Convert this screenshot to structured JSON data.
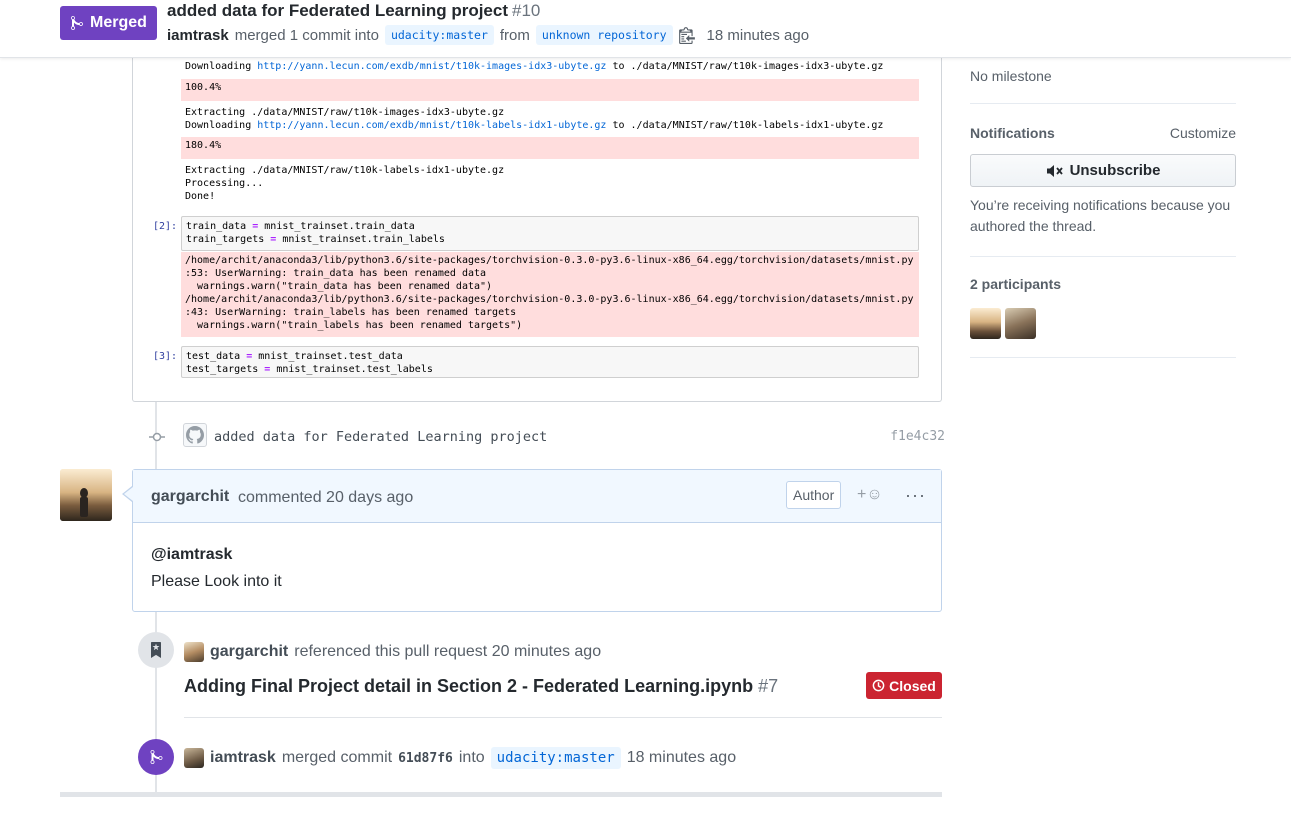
{
  "header": {
    "status_label": "Merged",
    "title": "added data for Federated Learning project",
    "number": "#10",
    "author": "iamtrask",
    "merge_text": "merged 1 commit into",
    "base_branch": "udacity:master",
    "from_text": "from",
    "head_branch": "unknown repository",
    "time": "18 minutes ago"
  },
  "notebook": {
    "line_download1_prefix": "Downloading ",
    "line_download1_url": "http://yann.lecun.com/exdb/mnist/t10k-images-idx3-ubyte.gz",
    "line_download1_suffix": " to ./data/MNIST/raw/t10k-images-idx3-ubyte.gz",
    "progress1": "100.4%",
    "extract1": "Extracting ./data/MNIST/raw/t10k-images-idx3-ubyte.gz",
    "line_download2_prefix": "Downloading ",
    "line_download2_url": "http://yann.lecun.com/exdb/mnist/t10k-labels-idx1-ubyte.gz",
    "line_download2_suffix": " to ./data/MNIST/raw/t10k-labels-idx1-ubyte.gz",
    "progress2": "180.4%",
    "extract2": "Extracting ./data/MNIST/raw/t10k-labels-idx1-ubyte.gz",
    "processing": "Processing...",
    "done": "Done!",
    "prompt2": "[2]:",
    "cell2_line1_a": "train_data ",
    "cell2_line1_op": "=",
    "cell2_line1_b": " mnist_trainset.train_data",
    "cell2_line2_a": "train_targets ",
    "cell2_line2_op": "=",
    "cell2_line2_b": " mnist_trainset.train_labels",
    "warning": "/home/archit/anaconda3/lib/python3.6/site-packages/torchvision-0.3.0-py3.6-linux-x86_64.egg/torchvision/datasets/mnist.py\n:53: UserWarning: train_data has been renamed data\n  warnings.warn(\"train_data has been renamed data\")\n/home/archit/anaconda3/lib/python3.6/site-packages/torchvision-0.3.0-py3.6-linux-x86_64.egg/torchvision/datasets/mnist.py\n:43: UserWarning: train_labels has been renamed targets\n  warnings.warn(\"train_labels has been renamed targets\")",
    "prompt3": "[3]:",
    "cell3_line1_a": "test_data ",
    "cell3_line1_op": "=",
    "cell3_line1_b": " mnist_trainset.test_data",
    "cell3_line2_a": "test_targets ",
    "cell3_line2_op": "=",
    "cell3_line2_b": " mnist_trainset.test_labels"
  },
  "commit": {
    "message": "added data for Federated Learning project",
    "sha": "f1e4c32"
  },
  "comment": {
    "author": "gargarchit",
    "time": "commented 20 days ago",
    "author_tag": "Author",
    "reaction": "+☺",
    "more": "···",
    "mention": "@iamtrask",
    "body": "Please Look into it"
  },
  "reference": {
    "who": "gargarchit",
    "text": "referenced this pull request 20 minutes ago",
    "title": "Adding Final Project detail in Section 2 - Federated Learning.ipynb",
    "number": "#7",
    "status": "Closed"
  },
  "merge_event": {
    "who": "iamtrask",
    "text_before": "merged commit",
    "sha": "61d87f6",
    "text_into": "into",
    "branch": "udacity:master",
    "time": "18 minutes ago"
  },
  "sidebar": {
    "milestone": "No milestone",
    "notifications_heading": "Notifications",
    "customize": "Customize",
    "unsubscribe": "Unsubscribe",
    "notification_reason": "You’re receiving notifications because you authored the thread.",
    "participants_heading": "2 participants"
  },
  "colors": {
    "merged_purple": "#6f42c1",
    "closed_red": "#cb2431",
    "link_blue": "#0366d6",
    "comment_header_bg": "#f1f8ff"
  }
}
